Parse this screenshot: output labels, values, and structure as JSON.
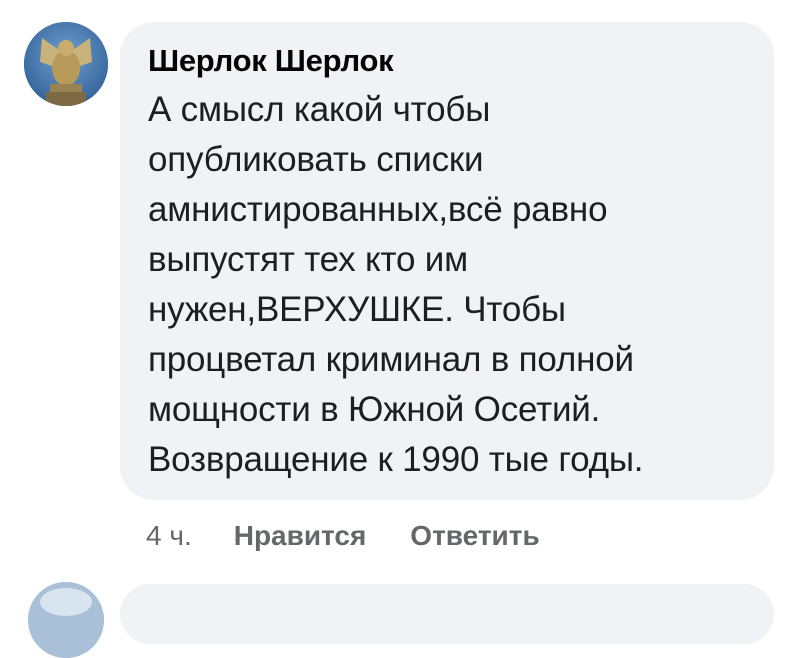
{
  "comment": {
    "author": "Шерлок Шерлок",
    "text": "А смысл какой чтобы\nопубликовать списки\nамнистированных,всё равно\nвыпустят тех кто им\nнужен,ВЕРХУШКЕ. Чтобы\nпроцветал криминал в полной\nмощности в Южной Осетий.\nВозвращение к 1990 тые годы.",
    "time": "4 ч.",
    "like_label": "Нравится",
    "reply_label": "Ответить",
    "avatar_icon": "griffin-statue-avatar"
  },
  "next_comment": {
    "avatar_icon": "partial-avatar"
  },
  "colors": {
    "bubble_bg": "#f0f2f5",
    "author": "#050505",
    "text": "#1c1e21",
    "meta": "#65676b",
    "avatar_bg": "#3a6fa8"
  }
}
